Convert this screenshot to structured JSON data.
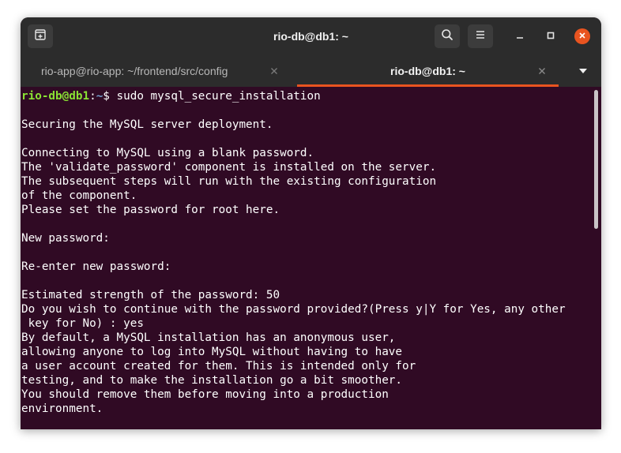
{
  "window": {
    "title": "rio-db@db1: ~"
  },
  "tabs": [
    {
      "label": "rio-app@rio-app: ~/frontend/src/config",
      "active": false
    },
    {
      "label": "rio-db@db1: ~",
      "active": true
    }
  ],
  "icons": {
    "new_tab": "new-tab-icon",
    "search": "search-icon",
    "menu": "hamburger-menu-icon",
    "minimize": "minimize-icon",
    "maximize": "maximize-icon",
    "close": "close-icon",
    "tab_close": "close-icon",
    "dropdown": "chevron-down-icon"
  },
  "colors": {
    "terminal_bg": "#300a24",
    "titlebar_bg": "#2c2c2c",
    "accent": "#e95420",
    "prompt_user": "#8ae234",
    "prompt_path": "#729fcf"
  },
  "terminal": {
    "prompt": {
      "user_host": "rio-db@db1",
      "separator": ":",
      "path": "~",
      "symbol": "$ ",
      "command": "sudo mysql_secure_installation"
    },
    "lines": [
      "",
      "Securing the MySQL server deployment.",
      "",
      "Connecting to MySQL using a blank password.",
      "The 'validate_password' component is installed on the server.",
      "The subsequent steps will run with the existing configuration",
      "of the component.",
      "Please set the password for root here.",
      "",
      "New password:",
      "",
      "Re-enter new password:",
      "",
      "Estimated strength of the password: 50",
      "Do you wish to continue with the password provided?(Press y|Y for Yes, any other",
      " key for No) : yes",
      "By default, a MySQL installation has an anonymous user,",
      "allowing anyone to log into MySQL without having to have",
      "a user account created for them. This is intended only for",
      "testing, and to make the installation go a bit smoother.",
      "You should remove them before moving into a production",
      "environment."
    ]
  }
}
